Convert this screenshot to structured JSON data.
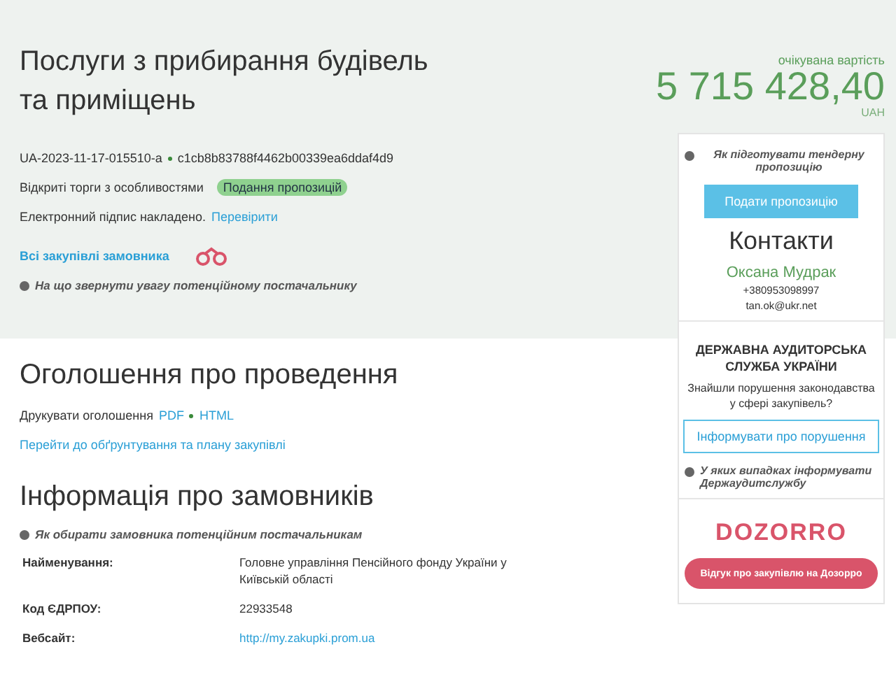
{
  "tender": {
    "title": "Послуги з прибирання будівель та приміщень",
    "id": "UA-2023-11-17-015510-a",
    "hash": "c1cb8b83788f4462b00339ea6ddaf4d9",
    "procedure": "Відкриті торги з особливостями",
    "status": "Подання пропозицій",
    "signature": "Електронний підпис накладено.",
    "verify_link": "Перевірити",
    "buyer_link": "Всі закупівлі замовника",
    "hint": "На що звернути увагу потенційному постачальнику"
  },
  "price": {
    "label": "очікувана вартість",
    "amount": "5 715 428,40",
    "currency": "UAH"
  },
  "sidebar": {
    "hint": "Як підготувати тендерну пропозицію",
    "submit_button": "Подати пропозицію",
    "contacts_title": "Контакти",
    "contact_name": "Оксана Мудрак",
    "phone": "+380953098997",
    "email": "tan.ok@ukr.net",
    "audit_title": "ДЕРЖАВНА АУДИТОРСЬКА СЛУЖБА УКРАЇНИ",
    "audit_text": "Знайшли порушення законодавства у сфері закупівель?",
    "audit_button": "Інформувати про порушення",
    "audit_hint": "У яких випадках інформувати Держаудитслужбу",
    "dozorro_logo": "DOZORRO",
    "dozorro_button": "Відгук про закупівлю на Дозорро"
  },
  "announcement": {
    "title": "Оголошення про проведення",
    "print_label": "Друкувати оголошення",
    "print_links": [
      "PDF",
      "HTML"
    ],
    "plan_link": "Перейти до обґрунтування та плану закупівлі"
  },
  "buyers": {
    "title": "Інформація про замовників",
    "hint": "Як обирати замовника потенційним постачальникам",
    "rows": [
      {
        "label": "Найменування:",
        "value": "Головне управління Пенсійного фонду України у Київській області",
        "kind": "text"
      },
      {
        "label": "Код ЄДРПОУ:",
        "value": "22933548",
        "kind": "text"
      },
      {
        "label": "Вебсайт:",
        "value": "http://my.zakupki.prom.ua",
        "kind": "link"
      }
    ]
  }
}
